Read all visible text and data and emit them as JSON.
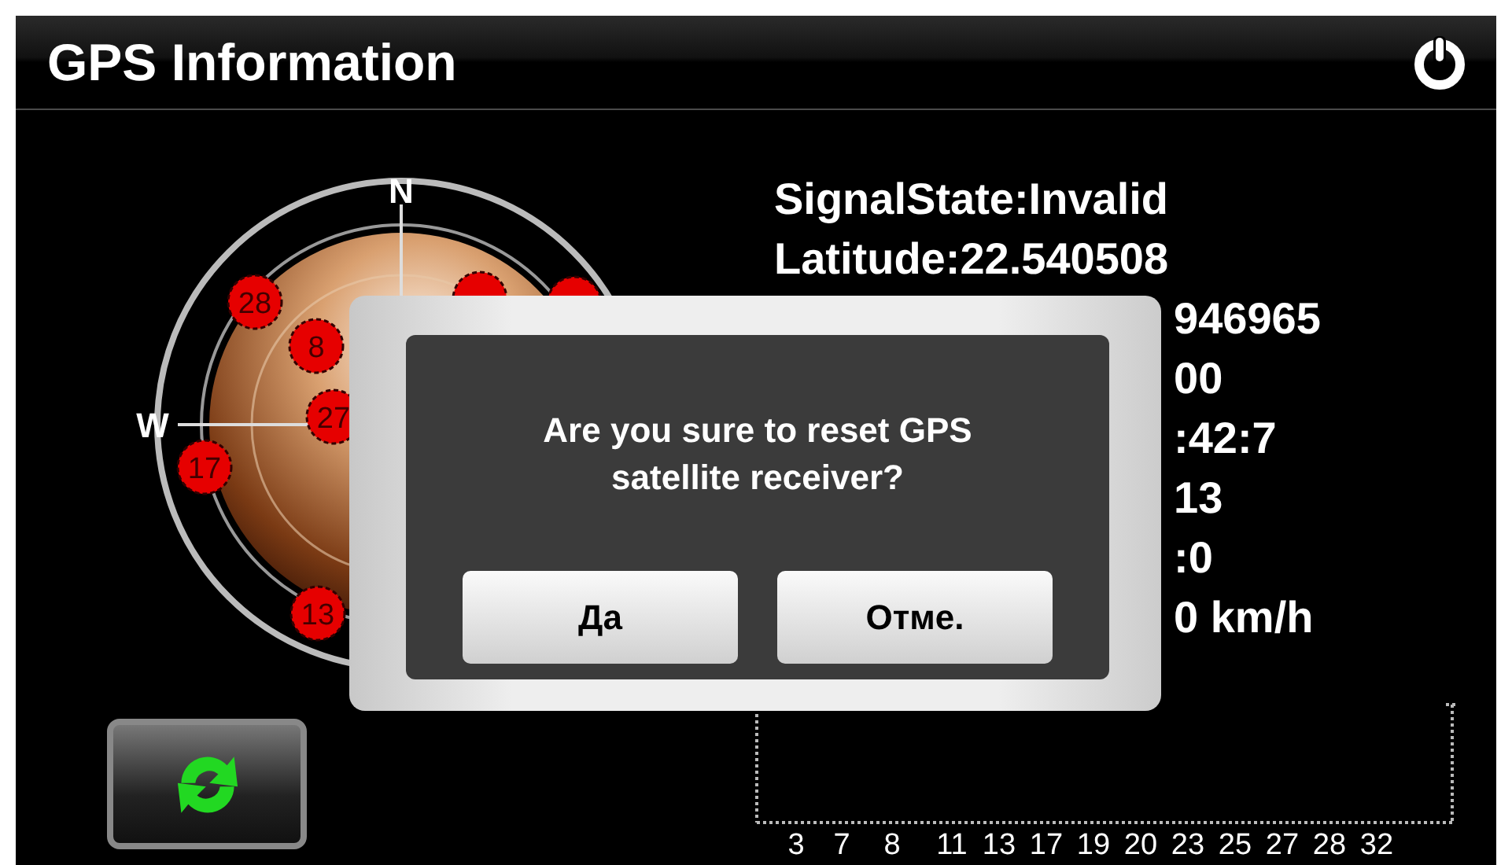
{
  "header": {
    "title": "GPS Information"
  },
  "sky_plot": {
    "north_label": "N",
    "west_label": "W",
    "satellites": [
      {
        "label": "28"
      },
      {
        "label": "8"
      },
      {
        "label": "27"
      },
      {
        "label": "17"
      },
      {
        "label": "13"
      }
    ]
  },
  "info_lines": [
    {
      "text": "SignalState:Invalid",
      "covered": false
    },
    {
      "text": "Latitude:22.540508",
      "covered": false
    },
    {
      "text": "946965",
      "covered": true
    },
    {
      "text": "00",
      "covered": true
    },
    {
      "text": ":42:7",
      "covered": true
    },
    {
      "text": "13",
      "covered": true
    },
    {
      "text": ":0",
      "covered": true
    },
    {
      "text": "0 km/h",
      "covered": true
    }
  ],
  "signal_chart": {
    "satellite_labels": [
      "3",
      "7",
      "8",
      "11",
      "13",
      "17",
      "19",
      "20",
      "23",
      "25",
      "27",
      "28",
      "32"
    ]
  },
  "dialog": {
    "message": "Are you sure to reset GPS satellite receiver?",
    "buttons": [
      "Да",
      "Отме."
    ]
  }
}
